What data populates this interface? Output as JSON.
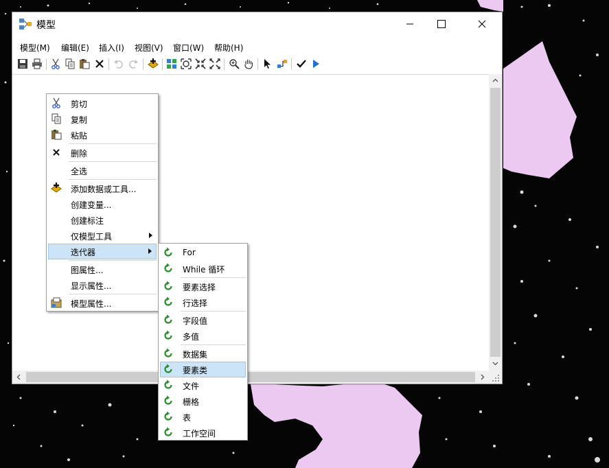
{
  "window": {
    "title": "模型"
  },
  "menubar": [
    "模型(M)",
    "编辑(E)",
    "插入(I)",
    "视图(V)",
    "窗口(W)",
    "帮助(H)"
  ],
  "toolbar": [
    {
      "icon": "save-icon"
    },
    {
      "icon": "print-icon"
    },
    {
      "icon": "cut-icon"
    },
    {
      "icon": "copy-icon"
    },
    {
      "icon": "paste-icon"
    },
    {
      "icon": "delete-icon"
    },
    {
      "icon": "undo-icon"
    },
    {
      "icon": "redo-icon"
    },
    {
      "icon": "add-data-icon"
    },
    {
      "icon": "auto-layout-icon"
    },
    {
      "icon": "full-extent-icon"
    },
    {
      "icon": "fixed-zoom-in-icon"
    },
    {
      "icon": "fixed-zoom-out-icon"
    },
    {
      "icon": "zoom-icon"
    },
    {
      "icon": "pan-icon"
    },
    {
      "icon": "select-icon"
    },
    {
      "icon": "connect-icon"
    },
    {
      "icon": "validate-icon"
    },
    {
      "icon": "run-icon"
    }
  ],
  "context_menu": [
    {
      "label": "剪切",
      "icon": "cut-icon"
    },
    {
      "label": "复制",
      "icon": "copy-icon"
    },
    {
      "label": "粘贴",
      "icon": "paste-icon"
    },
    {
      "label": "删除",
      "icon": "delete-icon"
    },
    {
      "label": "全选"
    },
    {
      "label": "添加数据或工具...",
      "icon": "add-data-icon"
    },
    {
      "label": "创建变量..."
    },
    {
      "label": "创建标注"
    },
    {
      "label": "仅模型工具",
      "submenu": true
    },
    {
      "label": "迭代器",
      "submenu": true,
      "highlighted": true
    },
    {
      "label": "图属性..."
    },
    {
      "label": "显示属性..."
    },
    {
      "label": "模型属性...",
      "icon": "model-properties-icon"
    }
  ],
  "iterator_submenu": [
    {
      "label": "For"
    },
    {
      "label": "While 循环"
    },
    {
      "label": "要素选择"
    },
    {
      "label": "行选择"
    },
    {
      "label": "字段值"
    },
    {
      "label": "多值"
    },
    {
      "label": "数据集"
    },
    {
      "label": "要素类",
      "highlighted": true
    },
    {
      "label": "文件"
    },
    {
      "label": "栅格"
    },
    {
      "label": "表"
    },
    {
      "label": "工作空间"
    }
  ],
  "colors": {
    "map_region": "#ecc9f1",
    "highlight": "#cce4f7",
    "iterator_icon": "#2e8b2e"
  }
}
